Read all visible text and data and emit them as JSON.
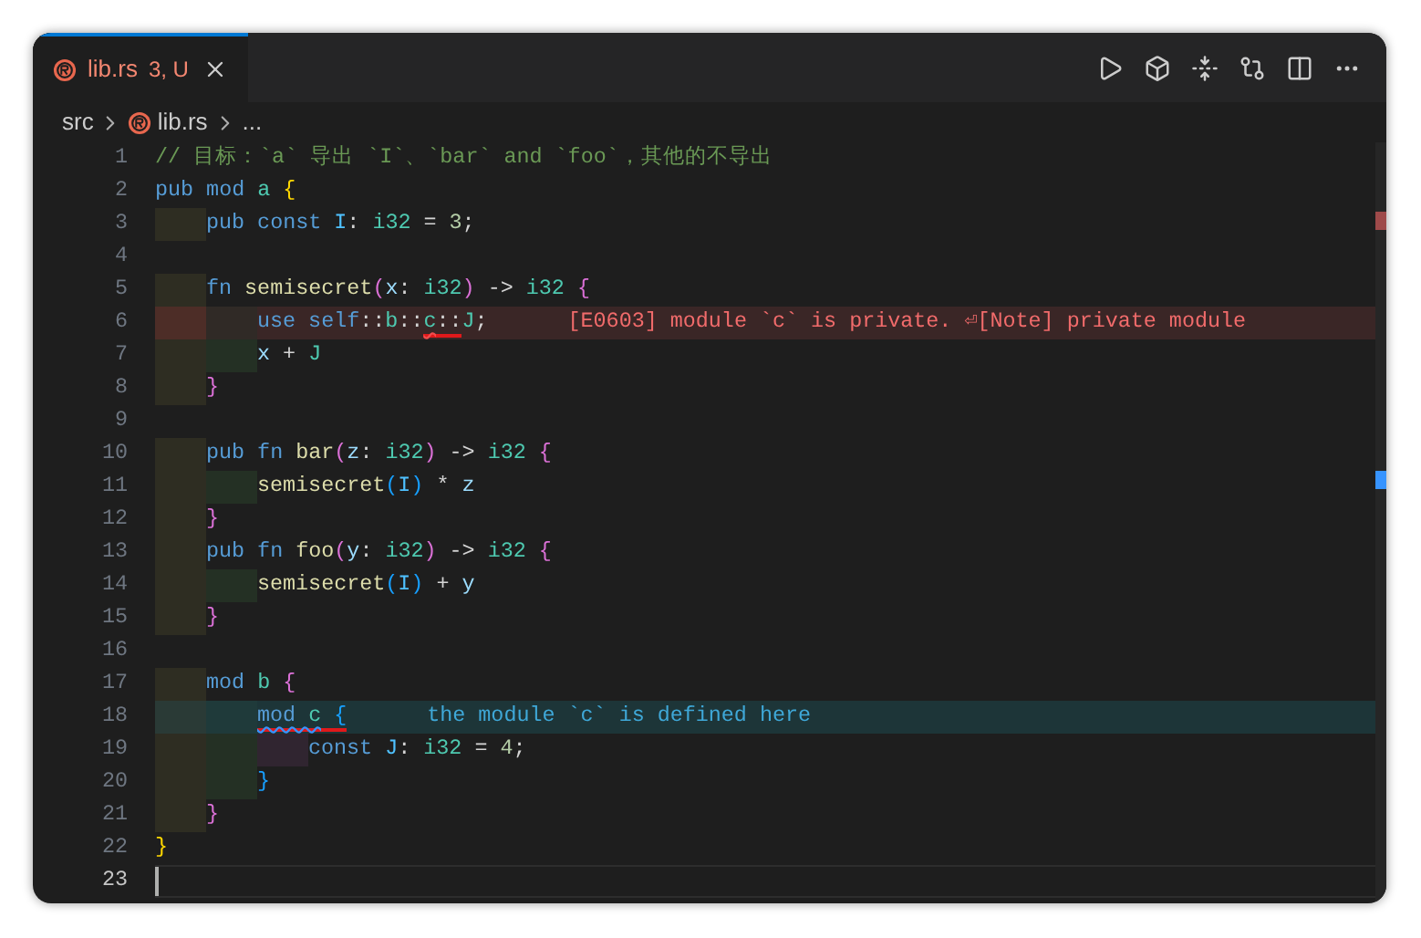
{
  "tab": {
    "name": "lib.rs",
    "badge": "3, U",
    "selected": true
  },
  "breadcrumb": [
    "src",
    "lib.rs",
    "..."
  ],
  "lines": [
    {
      "number": "1",
      "tokens": [
        {
          "text": "// 目标：`a` 导出 `I`、`bar` and `foo`，其他的不导出",
          "kind": "comment"
        }
      ]
    },
    {
      "number": "2",
      "tokens": [
        {
          "text": "pub mod ",
          "kind": "kw"
        },
        {
          "text": "a ",
          "kind": "type"
        },
        {
          "text": "{",
          "kind": "b1"
        }
      ]
    },
    {
      "number": "3",
      "guides": [
        {
          "color": "#2e2d22"
        }
      ],
      "tokens": [
        {
          "text": "pub const ",
          "kind": "kw"
        },
        {
          "text": "I",
          "kind": "const"
        },
        {
          "text": ": ",
          "kind": "op"
        },
        {
          "text": "i32",
          "kind": "type"
        },
        {
          "text": " = ",
          "kind": "op"
        },
        {
          "text": "3",
          "kind": "num"
        },
        {
          "text": ";",
          "kind": "op"
        }
      ]
    },
    {
      "number": "4"
    },
    {
      "number": "5",
      "guides": [
        {
          "color": "#2e2d22"
        }
      ],
      "tokens": [
        {
          "text": "fn ",
          "kind": "kw"
        },
        {
          "text": "semisecret",
          "kind": "fn"
        },
        {
          "text": "(",
          "kind": "b2"
        },
        {
          "text": "x",
          "kind": "var"
        },
        {
          "text": ": ",
          "kind": "op"
        },
        {
          "text": "i32",
          "kind": "type"
        },
        {
          "text": ")",
          "kind": "b2"
        },
        {
          "text": " -> ",
          "kind": "op"
        },
        {
          "text": "i32 ",
          "kind": "type"
        },
        {
          "text": "{",
          "kind": "b2"
        }
      ]
    },
    {
      "number": "6",
      "guides": [
        {
          "color": "#4d2d27"
        },
        {
          "color": "#302a26"
        }
      ],
      "tokens": [
        {
          "text": "use self",
          "kind": "kw"
        },
        {
          "text": "::",
          "kind": "op"
        },
        {
          "text": "b",
          "kind": "type"
        },
        {
          "text": "::",
          "kind": "op"
        },
        {
          "text": "c",
          "kind": "type",
          "squiggle": true,
          "marked": true
        },
        {
          "text": "::",
          "kind": "op",
          "marked": true
        },
        {
          "text": "J",
          "kind": "type"
        },
        {
          "text": ";",
          "kind": "op"
        }
      ],
      "diagnostic": {
        "kind": "error",
        "text": "[E0603] module `c` is private. ⏎[Note] private module"
      }
    },
    {
      "number": "7",
      "guides": [
        {
          "color": "#2e2d22"
        },
        {
          "color": "#243024"
        }
      ],
      "tokens": [
        {
          "text": "x",
          "kind": "var"
        },
        {
          "text": " + ",
          "kind": "op"
        },
        {
          "text": "J",
          "kind": "type"
        }
      ]
    },
    {
      "number": "8",
      "guides": [
        {
          "color": "#2e2d22"
        }
      ],
      "tokens": [
        {
          "text": "}",
          "kind": "b2"
        }
      ]
    },
    {
      "number": "9"
    },
    {
      "number": "10",
      "guides": [
        {
          "color": "#2e2d22"
        }
      ],
      "tokens": [
        {
          "text": "pub fn ",
          "kind": "kw"
        },
        {
          "text": "bar",
          "kind": "fn"
        },
        {
          "text": "(",
          "kind": "b2"
        },
        {
          "text": "z",
          "kind": "var"
        },
        {
          "text": ": ",
          "kind": "op"
        },
        {
          "text": "i32",
          "kind": "type"
        },
        {
          "text": ")",
          "kind": "b2"
        },
        {
          "text": " -> ",
          "kind": "op"
        },
        {
          "text": "i32 ",
          "kind": "type"
        },
        {
          "text": "{",
          "kind": "b2"
        }
      ]
    },
    {
      "number": "11",
      "guides": [
        {
          "color": "#2e2d22"
        },
        {
          "color": "#243024"
        }
      ],
      "tokens": [
        {
          "text": "semisecret",
          "kind": "fn"
        },
        {
          "text": "(",
          "kind": "b3"
        },
        {
          "text": "I",
          "kind": "const"
        },
        {
          "text": ")",
          "kind": "b3"
        },
        {
          "text": " * ",
          "kind": "op"
        },
        {
          "text": "z",
          "kind": "var"
        }
      ]
    },
    {
      "number": "12",
      "guides": [
        {
          "color": "#2e2d22"
        }
      ],
      "tokens": [
        {
          "text": "}",
          "kind": "b2"
        }
      ]
    },
    {
      "number": "13",
      "guides": [
        {
          "color": "#2e2d22"
        }
      ],
      "tokens": [
        {
          "text": "pub fn ",
          "kind": "kw"
        },
        {
          "text": "foo",
          "kind": "fn"
        },
        {
          "text": "(",
          "kind": "b2"
        },
        {
          "text": "y",
          "kind": "var"
        },
        {
          "text": ": ",
          "kind": "op"
        },
        {
          "text": "i32",
          "kind": "type"
        },
        {
          "text": ")",
          "kind": "b2"
        },
        {
          "text": " -> ",
          "kind": "op"
        },
        {
          "text": "i32 ",
          "kind": "type"
        },
        {
          "text": "{",
          "kind": "b2"
        }
      ]
    },
    {
      "number": "14",
      "guides": [
        {
          "color": "#2e2d22"
        },
        {
          "color": "#243024"
        }
      ],
      "tokens": [
        {
          "text": "semisecret",
          "kind": "fn"
        },
        {
          "text": "(",
          "kind": "b3"
        },
        {
          "text": "I",
          "kind": "const"
        },
        {
          "text": ")",
          "kind": "b3"
        },
        {
          "text": " + ",
          "kind": "op"
        },
        {
          "text": "y",
          "kind": "var"
        }
      ]
    },
    {
      "number": "15",
      "guides": [
        {
          "color": "#2e2d22"
        }
      ],
      "tokens": [
        {
          "text": "}",
          "kind": "b2"
        }
      ]
    },
    {
      "number": "16"
    },
    {
      "number": "17",
      "guides": [
        {
          "color": "#2e2d22"
        }
      ],
      "tokens": [
        {
          "text": "mod ",
          "kind": "kw"
        },
        {
          "text": "b ",
          "kind": "type"
        },
        {
          "text": "{",
          "kind": "b2"
        }
      ]
    },
    {
      "number": "18",
      "guides": [
        {
          "color": "#2a3a36"
        },
        {
          "color": "#1f3a3a"
        }
      ],
      "tokens": [
        {
          "text": "mod ",
          "kind": "kw",
          "squiggle": true,
          "marked": true
        },
        {
          "text": "c",
          "kind": "type",
          "squiggle": true,
          "marked": true
        },
        {
          "text": " {",
          "kind": "b3",
          "marked": true
        }
      ],
      "diagnostic": {
        "kind": "info",
        "text": "the module `c` is defined here"
      }
    },
    {
      "number": "19",
      "guides": [
        {
          "color": "#2e2d22"
        },
        {
          "color": "#243024"
        },
        {
          "color": "#302530"
        }
      ],
      "tokens": [
        {
          "text": "const ",
          "kind": "kw"
        },
        {
          "text": "J",
          "kind": "const"
        },
        {
          "text": ": ",
          "kind": "op"
        },
        {
          "text": "i32",
          "kind": "type"
        },
        {
          "text": " = ",
          "kind": "op"
        },
        {
          "text": "4",
          "kind": "num"
        },
        {
          "text": ";",
          "kind": "op"
        }
      ]
    },
    {
      "number": "20",
      "guides": [
        {
          "color": "#2e2d22"
        },
        {
          "color": "#243024"
        }
      ],
      "tokens": [
        {
          "text": "}",
          "kind": "b3"
        }
      ]
    },
    {
      "number": "21",
      "guides": [
        {
          "color": "#2e2d22"
        }
      ],
      "tokens": [
        {
          "text": "}",
          "kind": "b2"
        }
      ]
    },
    {
      "number": "22",
      "tokens": [
        {
          "text": "}",
          "kind": "b1"
        }
      ]
    },
    {
      "number": "23",
      "current": true
    }
  ]
}
